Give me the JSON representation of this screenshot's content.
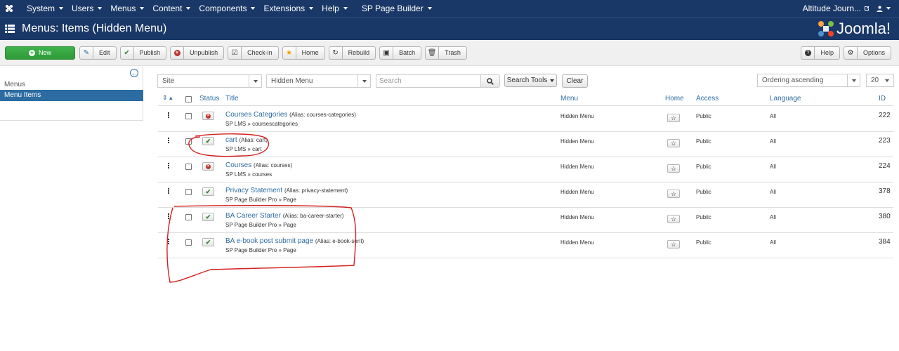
{
  "topnav": {
    "items": [
      "System",
      "Users",
      "Menus",
      "Content",
      "Components",
      "Extensions",
      "Help",
      "SP Page Builder"
    ],
    "site_name": "Altitude Journ..."
  },
  "header": {
    "title": "Menus: Items (Hidden Menu)",
    "brand": "Joomla!"
  },
  "toolbar": {
    "new": "New",
    "edit": "Edit",
    "publish": "Publish",
    "unpublish": "Unpublish",
    "checkin": "Check-in",
    "home": "Home",
    "rebuild": "Rebuild",
    "batch": "Batch",
    "trash": "Trash",
    "help": "Help",
    "options": "Options"
  },
  "sidebar": {
    "label": "Menus",
    "active": "Menu Items"
  },
  "filters": {
    "client": "Site",
    "menu": "Hidden Menu",
    "search_placeholder": "Search",
    "search_tools": "Search Tools",
    "clear": "Clear",
    "ordering": "Ordering ascending",
    "limit": "20"
  },
  "table": {
    "headers": {
      "status": "Status",
      "title": "Title",
      "menu": "Menu",
      "home": "Home",
      "access": "Access",
      "language": "Language",
      "id": "ID"
    },
    "rows": [
      {
        "title": "Courses Categories",
        "alias": "(Alias: courses-categories)",
        "sub": "SP LMS » coursescategories",
        "status": "unpublished",
        "menu": "Hidden Menu",
        "access": "Public",
        "language": "All",
        "id": "222"
      },
      {
        "title": "cart",
        "alias": "(Alias: cart)",
        "sub": "SP LMS » cart",
        "status": "published",
        "menu": "Hidden Menu",
        "access": "Public",
        "language": "All",
        "id": "223"
      },
      {
        "title": "Courses",
        "alias": "(Alias: courses)",
        "sub": "SP LMS » courses",
        "status": "unpublished",
        "menu": "Hidden Menu",
        "access": "Public",
        "language": "All",
        "id": "224"
      },
      {
        "title": "Privacy Statement",
        "alias": "(Alias: privacy-statement)",
        "sub": "SP Page Builder Pro » Page",
        "status": "published",
        "menu": "Hidden Menu",
        "access": "Public",
        "language": "All",
        "id": "378"
      },
      {
        "title": "BA Career Starter",
        "alias": "(Alias: ba-career-starter)",
        "sub": "SP Page Builder Pro » Page",
        "status": "published",
        "menu": "Hidden Menu",
        "access": "Public",
        "language": "All",
        "id": "380"
      },
      {
        "title": "BA e-book post submit page",
        "alias": "(Alias: e-book-sent)",
        "sub": "SP Page Builder Pro » Page",
        "status": "published",
        "menu": "Hidden Menu",
        "access": "Public",
        "language": "All",
        "id": "384"
      }
    ]
  },
  "colors": {
    "navbar": "#1a3867",
    "link": "#2d6ca2",
    "new_button": "#2f9a3a",
    "annotation": "#d42020"
  }
}
